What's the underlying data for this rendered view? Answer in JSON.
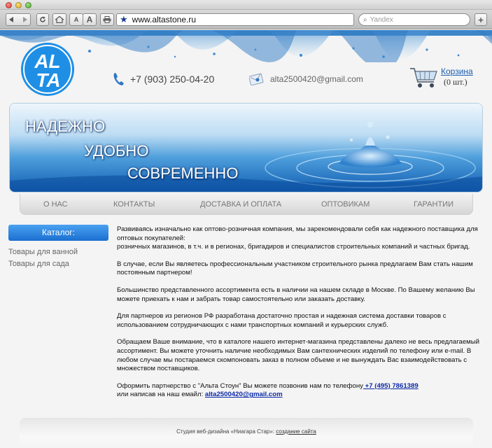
{
  "browser": {
    "address": "www.altastone.ru",
    "search_placeholder": "Yandex",
    "font_small": "A",
    "font_large": "A",
    "add_tab": "+"
  },
  "header": {
    "logo_text": "ALTA",
    "phone": "+7 (903) 250-04-20",
    "email": "alta2500420@gmail.com",
    "cart_label": "Корзина",
    "cart_count": "(0 шт.)"
  },
  "banner": {
    "line1": "НАДЕЖНО",
    "line2": "УДОБНО",
    "line3": "СОВРЕМЕННО"
  },
  "nav": {
    "items": [
      "О НАС",
      "КОНТАКТЫ",
      "ДОСТАВКА И ОПЛАТА",
      "ОПТОВИКАМ",
      "ГАРАНТИИ"
    ]
  },
  "sidebar": {
    "title": "Каталог:",
    "items": [
      "Товары для ванной",
      "Товары для сада"
    ]
  },
  "content": {
    "p1a": "Развиваясь изначально как оптово-розничная компания, мы зарекомендовали себя как надежного поставщика для оптовых покупателей:",
    "p1b": " розничных магазинов, в т.ч. и в регионах, бригадиров и специалистов строительных компаний и частных бригад.",
    "p2": "В случае, если Вы являетесь профессиональным участником строительного рынка предлагаем Вам стать нашим постоянным партнером!",
    "p3": "Большинство представленного ассортимента есть в наличии на нашем складе в Москве. По Вашему желанию Вы можете приехать к нам и  забрать товар самостоятельно или заказать доставку.",
    "p4": "Для партнеров из регионов РФ разработана достаточно простая и надежная система доставки товаров с использованием сотрудничающих с  нами транспортных компаний и курьерских служб.",
    "p5": "Обращаем Ваше внимание, что в каталоге нашего интернет-магазина представлены далеко не весь предлагаемый ассортимент. Вы можете  уточнить наличие необходимых Вам сантехнических изделий по телефону или e-mail. В любом случае мы постараемся скомпоновать заказ в  полном объеме и не вынуждать Вас взаимодействовать с множеством поставщиков.",
    "p6a": "Оформить партнерство с \"Альта Стоун\" Вы можете позвонив нам по телефону",
    "p6_phone": " +7 (495) 7861389",
    "p6b": " или написав на наш емайл: ",
    "p6_email": "alta2500420@gmail.com"
  },
  "footer": {
    "text": "Студия веб-дизайна «Ниагара Стар»: ",
    "link": "создание сайта"
  }
}
